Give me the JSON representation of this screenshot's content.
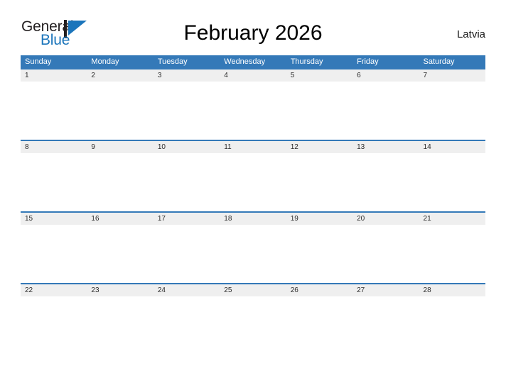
{
  "brand": {
    "name_part1": "General",
    "name_part2": "Blue",
    "mark_icon": "blue-triangle-flag-icon",
    "accent_color": "#1b75bb",
    "text_color": "#231f20"
  },
  "header": {
    "title": "February 2026",
    "region": "Latvia"
  },
  "calendar": {
    "month": "February",
    "year": "2026",
    "header_color": "#3479b8",
    "date_band_color": "#efefef",
    "weekdays": [
      "Sunday",
      "Monday",
      "Tuesday",
      "Wednesday",
      "Thursday",
      "Friday",
      "Saturday"
    ],
    "weeks": [
      {
        "days": [
          {
            "date": "1",
            "events": ""
          },
          {
            "date": "2",
            "events": ""
          },
          {
            "date": "3",
            "events": ""
          },
          {
            "date": "4",
            "events": ""
          },
          {
            "date": "5",
            "events": ""
          },
          {
            "date": "6",
            "events": ""
          },
          {
            "date": "7",
            "events": ""
          }
        ]
      },
      {
        "days": [
          {
            "date": "8",
            "events": ""
          },
          {
            "date": "9",
            "events": ""
          },
          {
            "date": "10",
            "events": ""
          },
          {
            "date": "11",
            "events": ""
          },
          {
            "date": "12",
            "events": ""
          },
          {
            "date": "13",
            "events": ""
          },
          {
            "date": "14",
            "events": ""
          }
        ]
      },
      {
        "days": [
          {
            "date": "15",
            "events": ""
          },
          {
            "date": "16",
            "events": ""
          },
          {
            "date": "17",
            "events": ""
          },
          {
            "date": "18",
            "events": ""
          },
          {
            "date": "19",
            "events": ""
          },
          {
            "date": "20",
            "events": ""
          },
          {
            "date": "21",
            "events": ""
          }
        ]
      },
      {
        "days": [
          {
            "date": "22",
            "events": ""
          },
          {
            "date": "23",
            "events": ""
          },
          {
            "date": "24",
            "events": ""
          },
          {
            "date": "25",
            "events": ""
          },
          {
            "date": "26",
            "events": ""
          },
          {
            "date": "27",
            "events": ""
          },
          {
            "date": "28",
            "events": ""
          }
        ]
      }
    ]
  }
}
